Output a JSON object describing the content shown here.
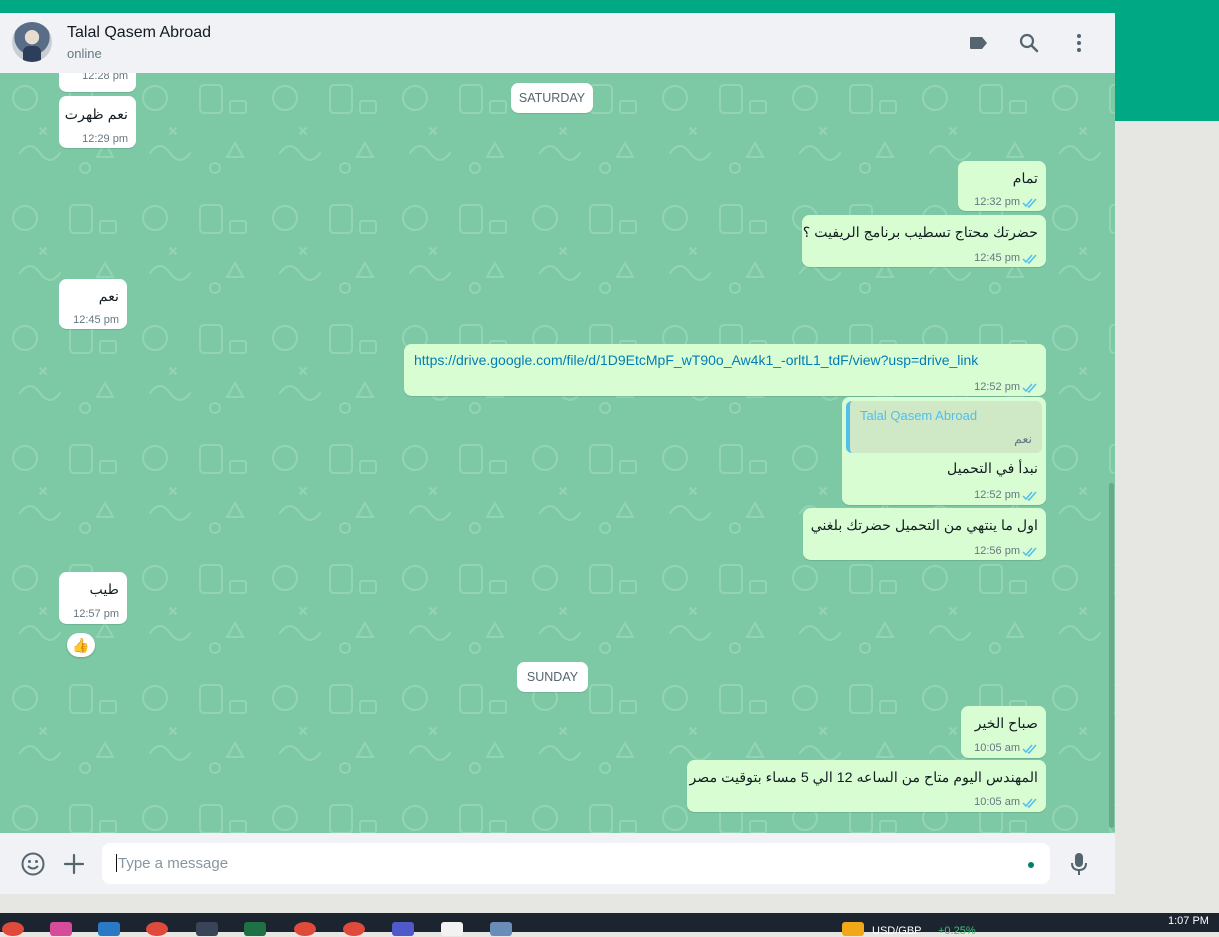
{
  "contact": {
    "name": "Talal Qasem Abroad",
    "status": "online"
  },
  "header_icons": [
    "label-icon",
    "search-icon",
    "menu-dots-icon"
  ],
  "dates": {
    "saturday": "SATURDAY",
    "sunday": "SUNDAY"
  },
  "messages": [
    {
      "dir": "in",
      "time": "12:28 pm"
    },
    {
      "dir": "in",
      "text": "نعم ظهرت",
      "time": "12:29 pm"
    },
    {
      "dir": "out",
      "text": "تمام",
      "time": "12:32 pm"
    },
    {
      "dir": "out",
      "text": "حضرتك محتاج تسطيب برنامج الريفيت ؟",
      "time": "12:45 pm"
    },
    {
      "dir": "in",
      "text": "نعم",
      "time": "12:45 pm"
    },
    {
      "dir": "out",
      "text": "https://drive.google.com/file/d/1D9EtcMpF_wT90o_Aw4k1_-orltL1_tdF/view?usp=drive_link",
      "time": "12:52 pm"
    },
    {
      "dir": "out",
      "quote_name": "Talal Qasem Abroad",
      "quote_text": "نعم",
      "text": "نبدأ في التحميل",
      "time": "12:52 pm"
    },
    {
      "dir": "out",
      "text": "اول ما ينتهي من التحميل حضرتك بلغني",
      "time": "12:56 pm"
    },
    {
      "dir": "in",
      "text": "طيب",
      "time": "12:57 pm",
      "reaction": "👍"
    },
    {
      "dir": "out",
      "text": "صباح الخير",
      "time": "10:05 am"
    },
    {
      "dir": "out",
      "text": "المهندس اليوم متاح من الساعه 12 الي 5 مساء بتوقيت مصر",
      "time": "10:05 am"
    }
  ],
  "composer": {
    "placeholder": "Type a message"
  },
  "taskbar": {
    "currency": "USD/GBP",
    "change": "+0.25%",
    "clock": "1:07 PM"
  },
  "colors": {
    "brand": "#00a884",
    "chat_bg": "#7ec9a5",
    "outgoing": "#d9fdd3",
    "incoming": "#ffffff",
    "tick": "#53bdeb"
  }
}
